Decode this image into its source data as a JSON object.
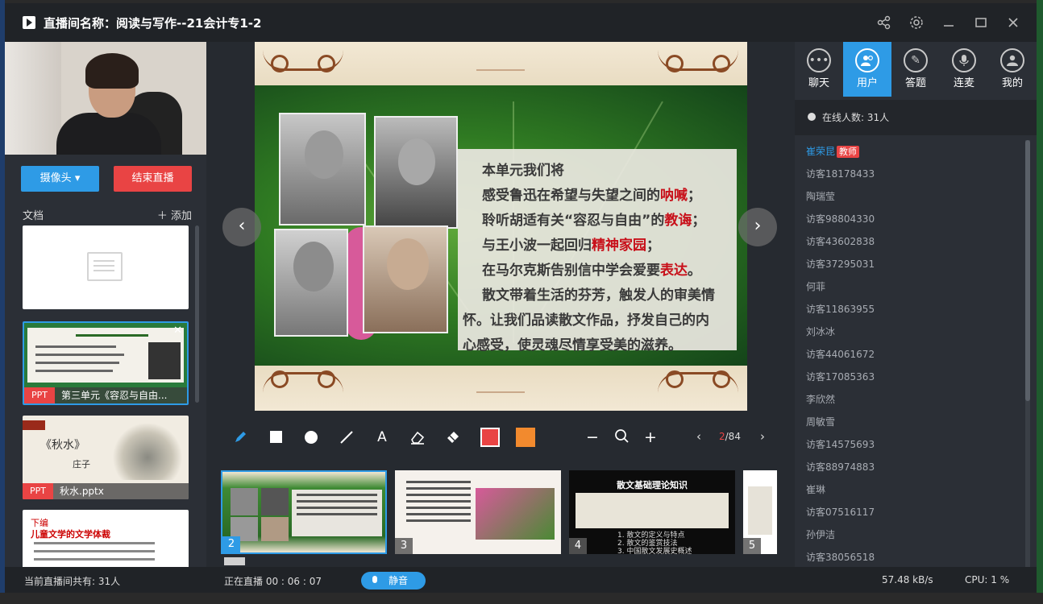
{
  "window": {
    "title": "直播间名称：阅读与写作--21会计专1-2"
  },
  "title_actions": [
    "share-icon",
    "settings-icon",
    "minimize-icon",
    "maximize-icon",
    "close-icon"
  ],
  "left": {
    "camera_button": "摄像头",
    "end_button": "结束直播",
    "docs_label": "文档",
    "add_label": "添加",
    "docs": [
      {
        "tag": "",
        "name": ""
      },
      {
        "tag": "PPT",
        "name": "第三单元《容忍与自由..."
      },
      {
        "tag": "PPT",
        "name": "秋水.pptx",
        "title": "《秋水》",
        "author": "庄子"
      },
      {
        "tag": "",
        "name": "",
        "title": "下编",
        "subtitle": "儿童文学的文学体裁"
      }
    ]
  },
  "slide": {
    "lines": [
      {
        "parts": [
          "本单元我们将"
        ]
      },
      {
        "parts": [
          "感受鲁迅在希望与失望之间的",
          "呐喊",
          "；"
        ]
      },
      {
        "parts": [
          "聆听胡适有关“容忍与自由”的",
          "教诲",
          "；"
        ]
      },
      {
        "parts": [
          "与王小波一起回归",
          "精神家园",
          "；"
        ]
      },
      {
        "parts": [
          "在马尔克斯告别信中学会爱要",
          "表达",
          "。"
        ]
      },
      {
        "parts": [
          "散文带着生活的芬芳，触发人的审美情"
        ]
      },
      {
        "parts": [
          "怀。让我们品读散文作品，抒发自己的内"
        ]
      },
      {
        "parts": [
          "心感受，使灵魂尽情享受美的滋养。"
        ]
      }
    ],
    "accent_color": "#c8101a"
  },
  "toolbar": {
    "tools": [
      "pen-icon",
      "rectangle-icon",
      "circle-icon",
      "line-icon",
      "text-icon",
      "eraser-icon",
      "clear-icon"
    ],
    "colors": {
      "stroke": "#e94444",
      "fill": "#f28a2e"
    },
    "page_current": "2",
    "page_total": "/84"
  },
  "thumbs": [
    {
      "num": "2"
    },
    {
      "num": "3"
    },
    {
      "num": "4",
      "title": "散文基础理论知识",
      "items": [
        "1. 散文的定义与特点",
        "2. 散文的鉴赏技法",
        "3. 中国散文发展史概述"
      ]
    },
    {
      "num": "5"
    }
  ],
  "right": {
    "tabs": [
      "聊天",
      "用户",
      "答题",
      "连麦",
      "我的"
    ],
    "online_label": "在线人数: 31人",
    "teacher_name": "崔荣昆",
    "teacher_badge": "教师",
    "users": [
      "访客18178433",
      "陶瑞莹",
      "访客98804330",
      "访客43602838",
      "访客37295031",
      "何菲",
      "访客11863955",
      "刘冰冰",
      "访客44061672",
      "访客17085363",
      "李欣然",
      "周敏雪",
      "访客14575693",
      "访客88974883",
      "崔琳",
      "访客07516117",
      "孙伊洁",
      "访客38056518"
    ]
  },
  "status": {
    "count": "当前直播间共有: 31人",
    "live": "正在直播 00 : 06 : 07",
    "mute": "静音",
    "speed": "57.48 kB/s",
    "cpu": "CPU:  1 %"
  }
}
